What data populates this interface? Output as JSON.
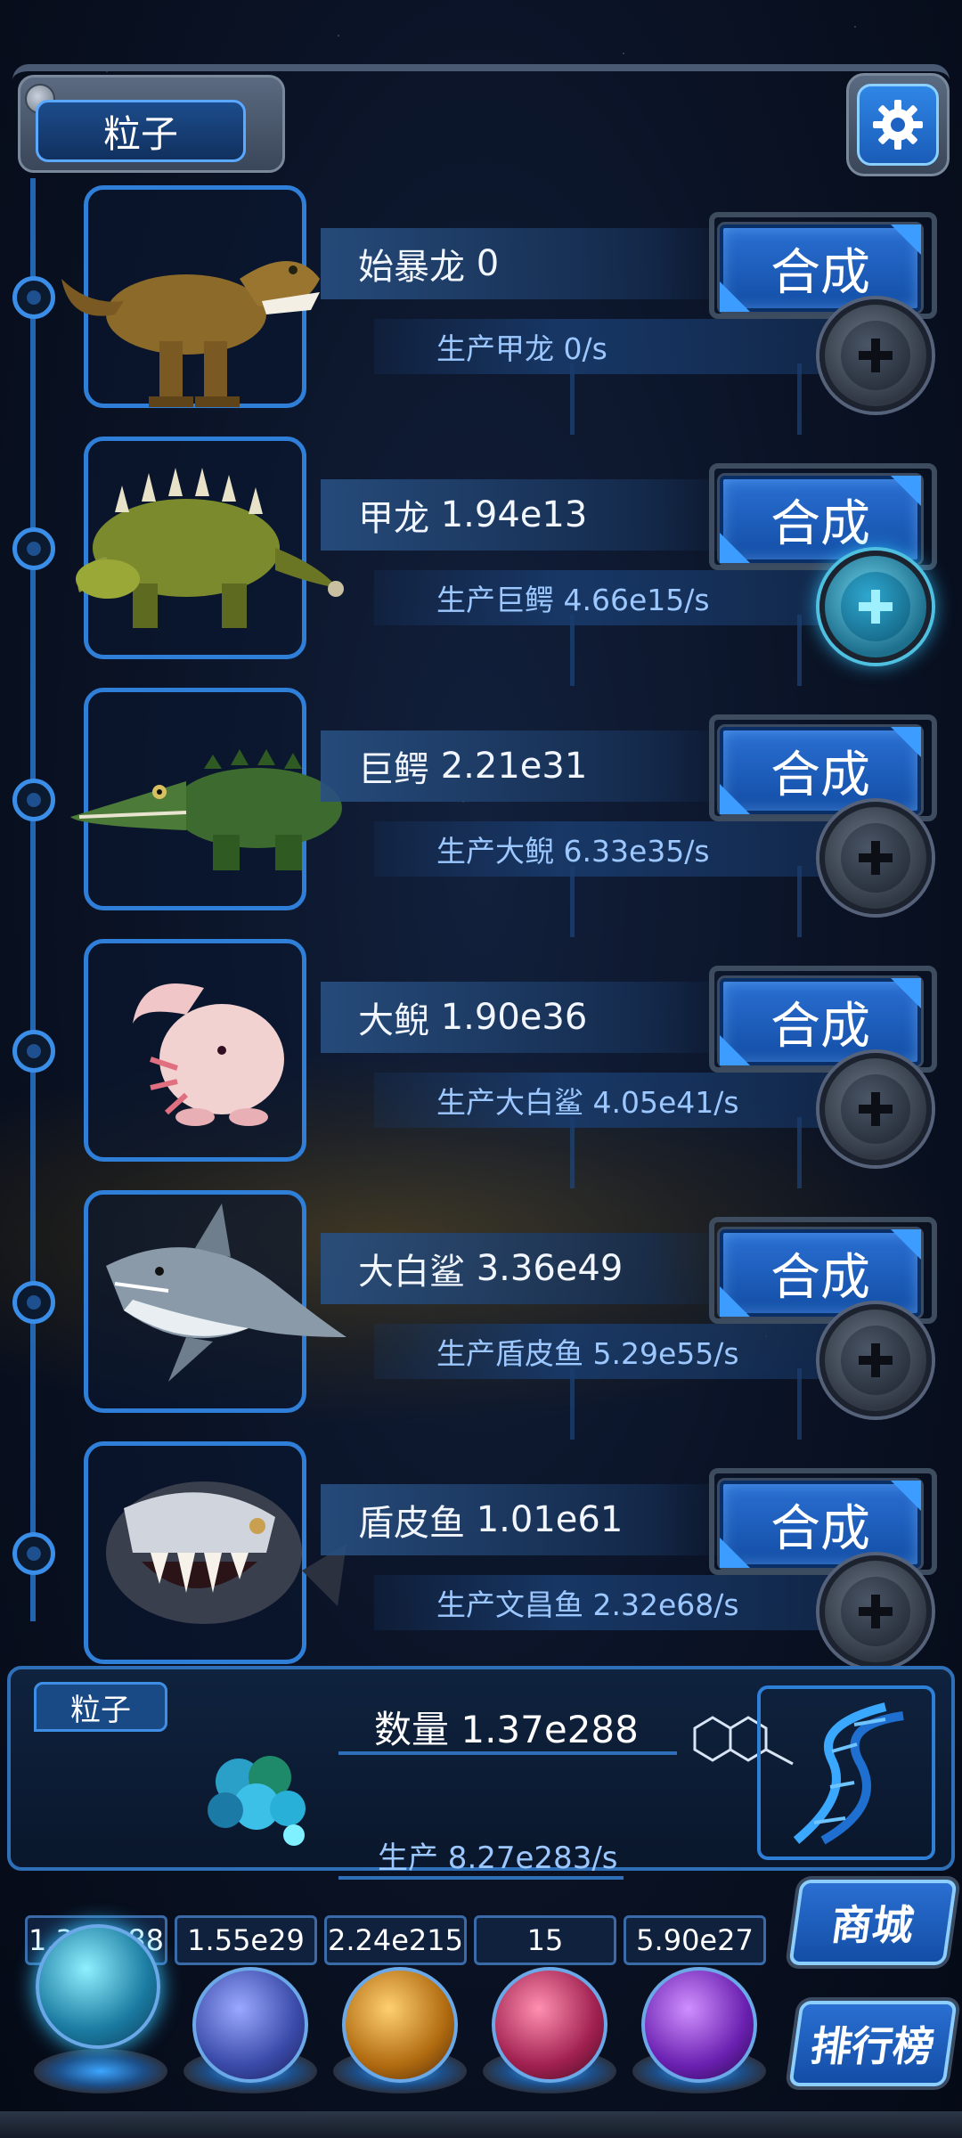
{
  "header": {
    "tab_label": "粒子",
    "settings_icon": "gear-icon"
  },
  "creatures": [
    {
      "name": "始暴龙",
      "count": "0",
      "production": "生产甲龙 0/s",
      "synth_label": "合成",
      "plus_active": false,
      "icon": "trex-icon"
    },
    {
      "name": "甲龙",
      "count": "1.94e13",
      "production": "生产巨鳄 4.66e15/s",
      "synth_label": "合成",
      "plus_active": true,
      "icon": "ankylosaurus-icon"
    },
    {
      "name": "巨鳄",
      "count": "2.21e31",
      "production": "生产大鲵 6.33e35/s",
      "synth_label": "合成",
      "plus_active": false,
      "icon": "crocodile-icon"
    },
    {
      "name": "大鲵",
      "count": "1.90e36",
      "production": "生产大白鲨 4.05e41/s",
      "synth_label": "合成",
      "plus_active": false,
      "icon": "axolotl-icon"
    },
    {
      "name": "大白鲨",
      "count": "3.36e49",
      "production": "生产盾皮鱼 5.29e55/s",
      "synth_label": "合成",
      "plus_active": false,
      "icon": "shark-icon"
    },
    {
      "name": "盾皮鱼",
      "count": "1.01e61",
      "production": "生产文昌鱼 2.32e68/s",
      "synth_label": "合成",
      "plus_active": false,
      "icon": "dunkleosteus-icon"
    }
  ],
  "particle_panel": {
    "label": "粒子",
    "count_text": "数量 1.37e288",
    "production_text": "生产 8.27e283/s"
  },
  "resources": [
    {
      "value": "1.37e288",
      "icon": "atom-orb-icon",
      "color": "#2fb7d6"
    },
    {
      "value": "1.55e29",
      "icon": "lightning-orb-icon",
      "color": "#4a64c8"
    },
    {
      "value": "2.24e215",
      "icon": "fire-orb-icon",
      "color": "#c8861e"
    },
    {
      "value": "15",
      "icon": "brain-orb-icon",
      "color": "#c2356a"
    },
    {
      "value": "5.90e27",
      "icon": "vortex-orb-icon",
      "color": "#7a34c8"
    }
  ],
  "side_buttons": {
    "shop": "商城",
    "ranking": "排行榜"
  },
  "colors": {
    "accent": "#2a6fd2",
    "frame": "#3e4c60",
    "glow": "#3da6ff"
  }
}
